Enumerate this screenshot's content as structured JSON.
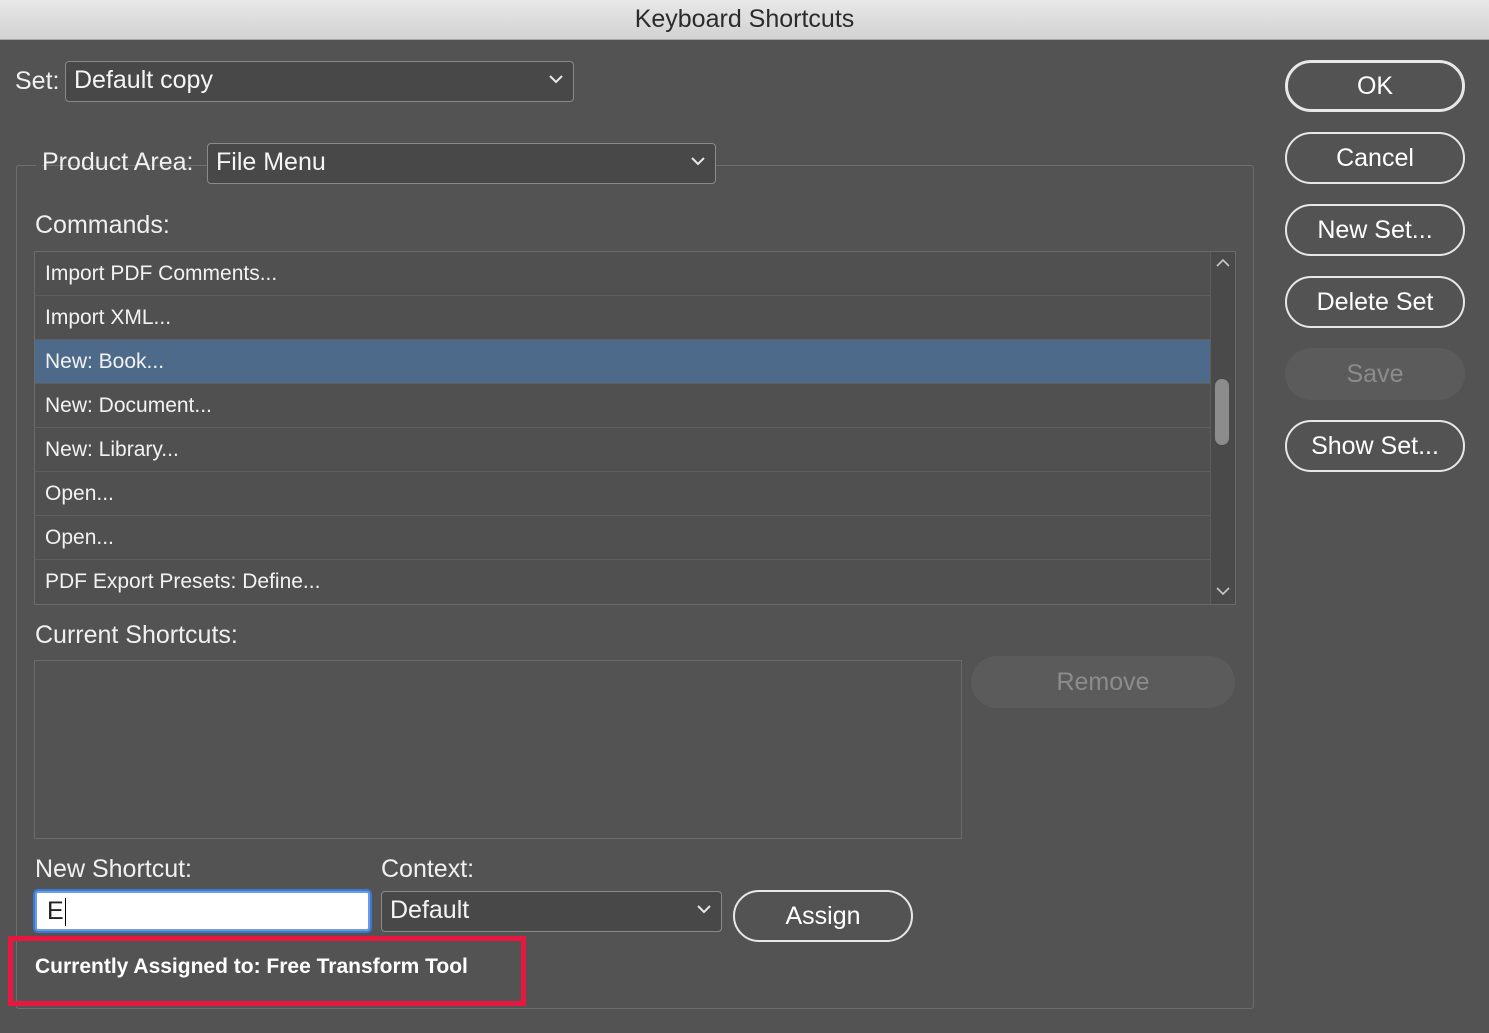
{
  "window": {
    "title": "Keyboard Shortcuts"
  },
  "set": {
    "label": "Set:",
    "selected": "Default copy"
  },
  "product_area": {
    "label": "Product Area:",
    "selected": "File Menu"
  },
  "commands": {
    "label": "Commands:",
    "items": [
      {
        "label": "Import PDF Comments...",
        "selected": false
      },
      {
        "label": "Import XML...",
        "selected": false
      },
      {
        "label": "New: Book...",
        "selected": true
      },
      {
        "label": "New: Document...",
        "selected": false
      },
      {
        "label": "New: Library...",
        "selected": false
      },
      {
        "label": "Open...",
        "selected": false
      },
      {
        "label": "Open...",
        "selected": false
      },
      {
        "label": "PDF Export Presets: Define...",
        "selected": false
      }
    ]
  },
  "current_shortcuts": {
    "label": "Current Shortcuts:",
    "remove_label": "Remove"
  },
  "new_shortcut": {
    "label": "New Shortcut:",
    "value": "E"
  },
  "context": {
    "label": "Context:",
    "selected": "Default"
  },
  "assign_label": "Assign",
  "currently_assigned": "Currently Assigned to: Free Transform Tool",
  "buttons": {
    "ok": "OK",
    "cancel": "Cancel",
    "new_set": "New Set...",
    "delete_set": "Delete Set",
    "save": "Save",
    "show_set": "Show Set..."
  },
  "colors": {
    "background": "#535353",
    "selection": "#4d6a8a",
    "highlight_annotation": "#e8173f"
  },
  "icons": {
    "dropdown": "chevron-down-icon",
    "scroll_up": "chevron-up-icon",
    "scroll_down": "chevron-down-icon"
  }
}
